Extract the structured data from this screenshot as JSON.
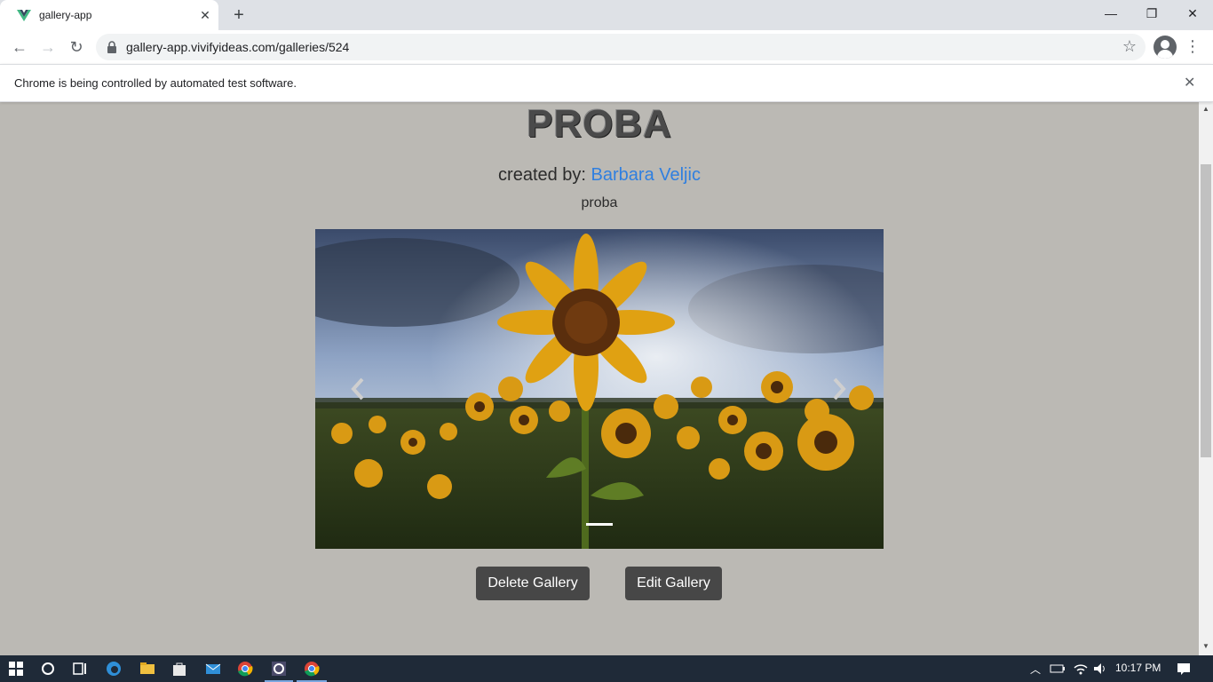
{
  "browser": {
    "tab_title": "gallery-app",
    "tab_close": "✕",
    "new_tab": "+",
    "url": "gallery-app.vivifyideas.com/galleries/524",
    "window_minimize": "—",
    "window_restore": "❐",
    "window_close": "✕",
    "back": "←",
    "forward": "→",
    "reload": "↻",
    "bookmark": "☆",
    "menu": "⋮"
  },
  "infobar": {
    "text": "Chrome is being controlled by automated test software.",
    "close": "✕"
  },
  "gallery": {
    "title": "PROBA",
    "created_by_label": "created by: ",
    "author": "Barbara Veljic",
    "description": "proba",
    "delete_label": "Delete Gallery",
    "edit_label": "Edit Gallery",
    "image_alt": "sunflower field"
  },
  "taskbar": {
    "time": "10:17 PM"
  },
  "colors": {
    "page_bg": "#bbb9b4",
    "link": "#2f7fe0",
    "button_bg": "#474747",
    "taskbar_bg": "#1f2a38"
  },
  "icons": {
    "favicon": "vue-icon",
    "lock": "lock-icon",
    "star": "star-icon",
    "profile": "profile-icon"
  }
}
